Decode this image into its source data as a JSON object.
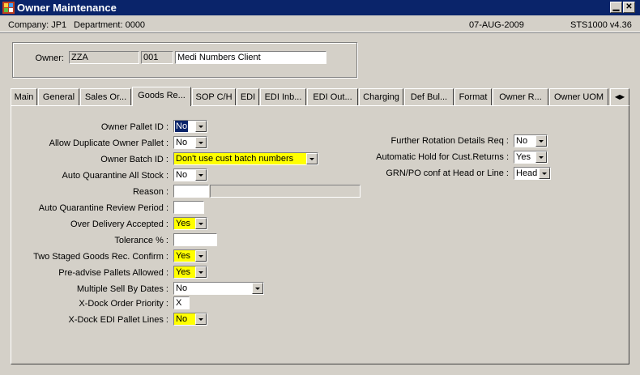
{
  "window": {
    "title": "Owner Maintenance",
    "minimize": "▁",
    "close": "✕"
  },
  "header": {
    "company": "Company:  JP1",
    "department": "Department:  0000",
    "date": "07-AUG-2009",
    "version": "STS1000  v4.36"
  },
  "owner": {
    "label": "Owner:",
    "code": "ZZA",
    "number": "001",
    "name": "Medi Numbers Client"
  },
  "tabs": [
    "Main",
    "General",
    "Sales Or...",
    "Goods Re...",
    "SOP C/H",
    "EDI",
    "EDI Inb...",
    "EDI Out...",
    "Charging",
    "Def Bul...",
    "Format",
    "Owner R...",
    "Owner UOM"
  ],
  "tab_scroll": "◀▶",
  "left_fields": {
    "owner_pallet_id": {
      "label": "Owner Pallet ID :",
      "value": "No"
    },
    "allow_duplicate": {
      "label": "Allow Duplicate Owner Pallet :",
      "value": "No"
    },
    "owner_batch_id": {
      "label": "Owner Batch ID :",
      "value": "Don't use cust batch numbers"
    },
    "auto_quarantine": {
      "label": "Auto Quarantine All Stock :",
      "value": "No"
    },
    "reason": {
      "label": "Reason :",
      "value": "",
      "desc": ""
    },
    "auto_q_review": {
      "label": "Auto Quarantine Review Period :",
      "value": ""
    },
    "over_delivery": {
      "label": "Over Delivery Accepted :",
      "value": "Yes"
    },
    "tolerance": {
      "label": "Tolerance  % :",
      "value": ""
    },
    "two_staged": {
      "label": "Two Staged Goods Rec. Confirm :",
      "value": "Yes"
    },
    "pre_advise": {
      "label": "Pre-advise Pallets Allowed :",
      "value": "Yes"
    },
    "multiple_sell_by": {
      "label": "Multiple Sell By Dates :",
      "value": "No"
    },
    "xdock_priority": {
      "label": "X-Dock Order Priority :",
      "value": "X"
    },
    "xdock_edi": {
      "label": "X-Dock EDI Pallet Lines :",
      "value": "No"
    }
  },
  "right_fields": {
    "further_rotation": {
      "label": "Further Rotation Details Req :",
      "value": "No"
    },
    "auto_hold": {
      "label": "Automatic Hold for Cust.Returns :",
      "value": "Yes"
    },
    "grn_po": {
      "label": "GRN/PO conf at Head or Line :",
      "value": "Head"
    }
  }
}
